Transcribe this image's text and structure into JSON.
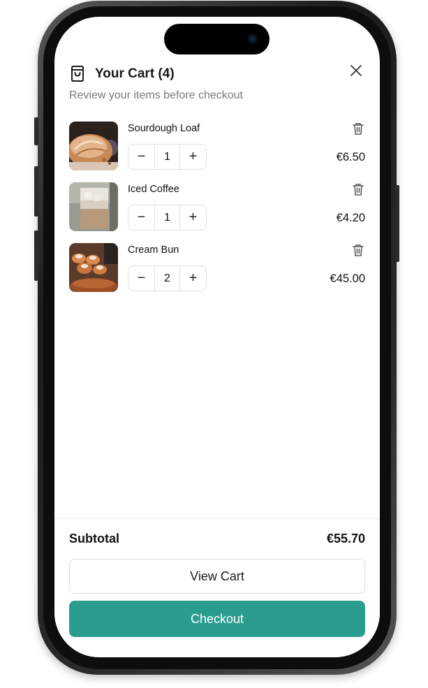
{
  "cart": {
    "title": "Your Cart (4)",
    "subtitle": "Review your items before checkout",
    "icons": {
      "bag": "shopping-bag-icon",
      "close": "close-icon",
      "remove": "trash-icon",
      "decrease": "minus",
      "increase": "plus"
    },
    "decrease_symbol": "−",
    "increase_symbol": "+",
    "items": [
      {
        "name": "Sourdough Loaf",
        "quantity": "1",
        "price": "€6.50",
        "image": "sourdough-loaf-photo"
      },
      {
        "name": "Iced Coffee",
        "quantity": "1",
        "price": "€4.20",
        "image": "iced-coffee-photo"
      },
      {
        "name": "Cream Bun",
        "quantity": "2",
        "price": "€45.00",
        "image": "cream-bun-photo"
      }
    ]
  },
  "footer": {
    "subtotal_label": "Subtotal",
    "subtotal_value": "€55.70",
    "view_cart_label": "View Cart",
    "checkout_label": "Checkout"
  },
  "colors": {
    "accent": "#2a9d8f",
    "text": "#111111",
    "muted": "#7a7a7a",
    "border": "#e0e0e0"
  }
}
